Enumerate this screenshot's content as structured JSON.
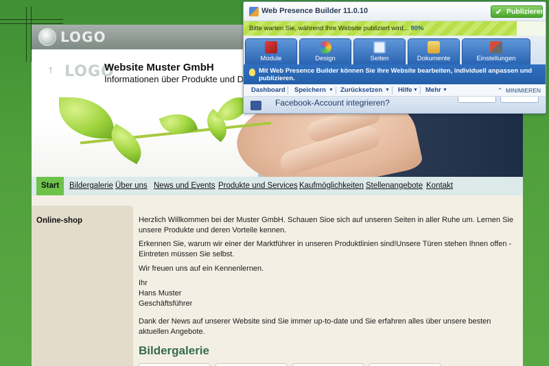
{
  "site": {
    "logo_text": "LOGO",
    "header_logo_text": "LOGO",
    "title": "Website Muster GmbH",
    "subtitle": "Informationen über Produkte und Dienstleistungen"
  },
  "nav": {
    "items": [
      {
        "label": "Start",
        "active": true
      },
      {
        "label": "Bildergalerie"
      },
      {
        "label": "Über uns"
      },
      {
        "label": "News und Events"
      },
      {
        "label": "Produkte und Services"
      },
      {
        "label": "Kaufmöglichkeiten"
      },
      {
        "label": "Stellenangebote"
      },
      {
        "label": "Kontakt"
      }
    ]
  },
  "sidebar": {
    "title": "Online-shop"
  },
  "main": {
    "p1": "Herzlich Willkommen bei der Muster GmbH. Schauen Sioe sich auf unseren Seiten in aller Ruhe um. Lernen Sie unsere Produkte und deren Vorteile kennen.",
    "p2": "Erkennen Sie, warum wir einer der Marktführer in unseren Produktlinien sind!Unsere Türen stehen Ihnen offen - Eintreten müssen Sie selbst.",
    "p3": "Wir freuen uns auf ein Kennenlernen.",
    "sig1": "Ihr",
    "sig2": "Hans Muster",
    "sig3": "Geschäftsführer",
    "p4": "Dank der News auf unserer Website sind Sie immer up-to-date und Sie erfahren alles über unsere besten aktuellen Angebote.",
    "gallery_title": "Bildergalerie"
  },
  "wpb": {
    "title": "Web Presence Builder 11.0.10",
    "publish_label": "Publizieren",
    "progress_text": "Bitte warten Sie, während Ihre Website publiziert wird...",
    "progress_value": "90%",
    "progress_fraction": 0.9,
    "tabs": [
      {
        "label": "Module",
        "icon": "module-icon"
      },
      {
        "label": "Design",
        "icon": "design-icon"
      },
      {
        "label": "Seiten",
        "icon": "pages-icon"
      },
      {
        "label": "Dokumente",
        "icon": "documents-icon"
      },
      {
        "label": "Einstellungen",
        "icon": "settings-icon"
      }
    ],
    "info_text": "Mit Web Presence Builder können Sie Ihre Website bearbeiten, individuell anpassen und publizieren.",
    "menu": {
      "dashboard": "Dashboard",
      "save": "Speichern",
      "reset": "Zurücksetzen",
      "help": "Hilfe",
      "more": "Mehr",
      "minimize": "MINIMIEREN"
    },
    "notification": "Facebook-Account integrieren?"
  },
  "colors": {
    "nav_active": "#6dc24a",
    "wpb_tab": "#2a64b3",
    "gallery_title": "#356b4c",
    "publish_button": "#4aa62b"
  }
}
